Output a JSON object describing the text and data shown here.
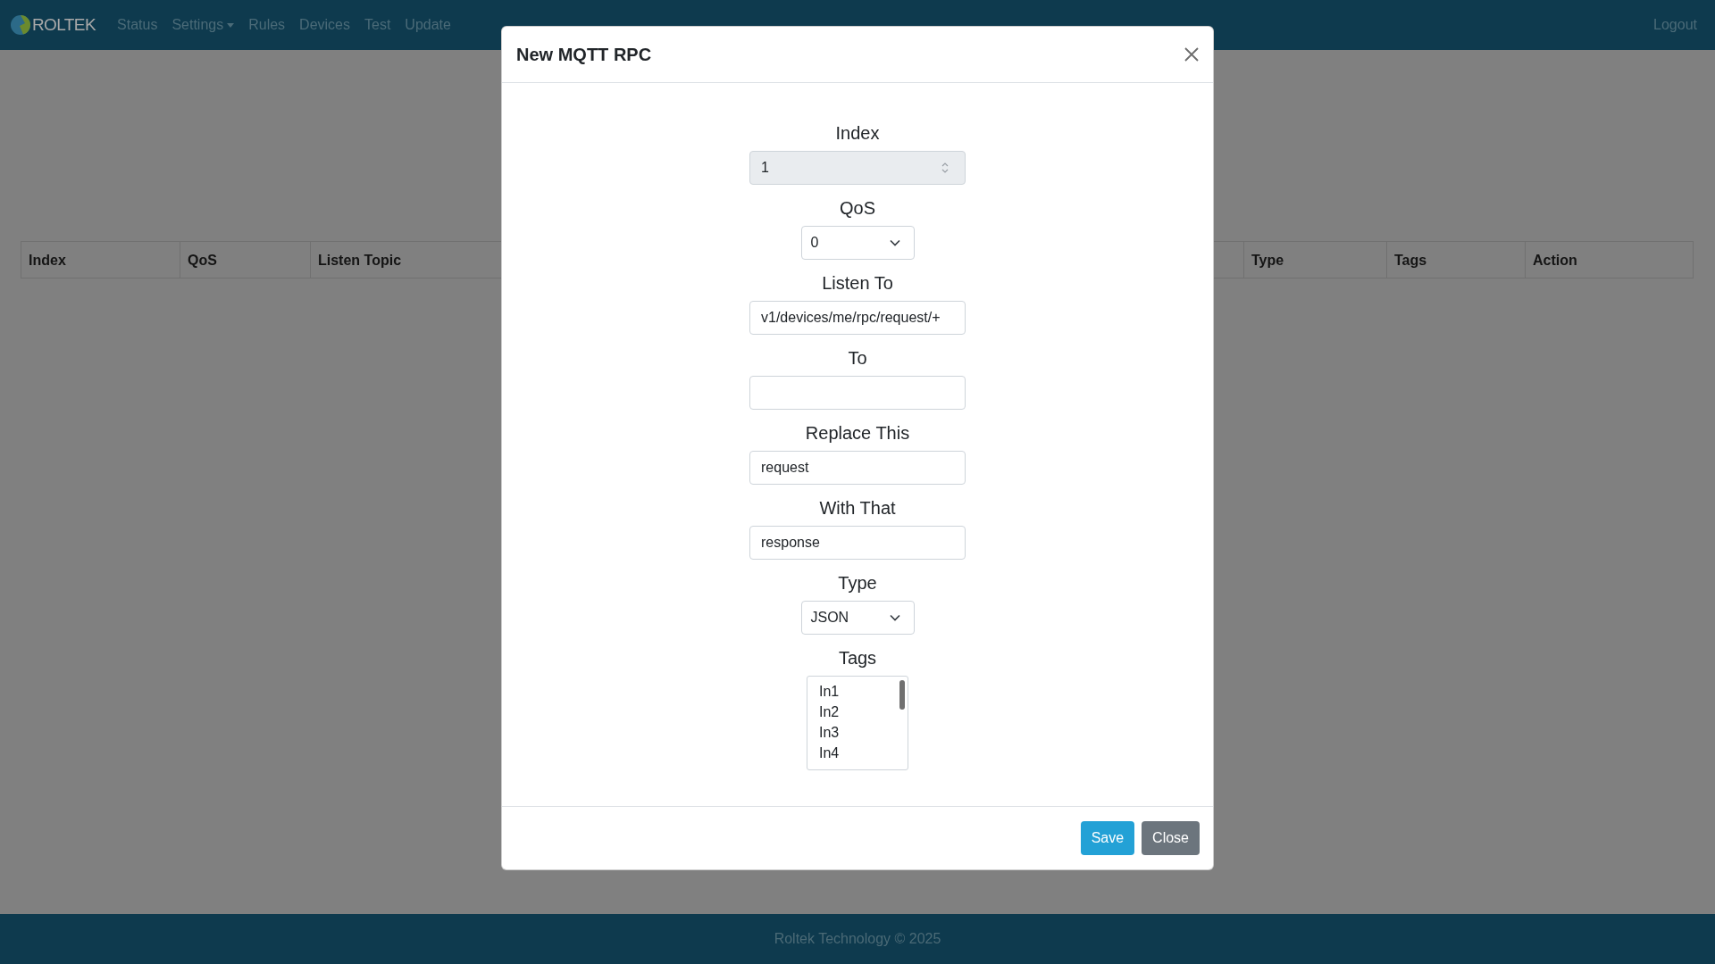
{
  "navbar": {
    "brand": "ROLTEK",
    "items": [
      {
        "label": "Status",
        "dropdown": false
      },
      {
        "label": "Settings",
        "dropdown": true
      },
      {
        "label": "Rules",
        "dropdown": false
      },
      {
        "label": "Devices",
        "dropdown": false
      },
      {
        "label": "Test",
        "dropdown": false
      },
      {
        "label": "Update",
        "dropdown": false
      }
    ],
    "logout": "Logout"
  },
  "table": {
    "columns": [
      "Index",
      "QoS",
      "Listen Topic",
      "Type",
      "Tags",
      "Action"
    ]
  },
  "modal": {
    "title": "New MQTT RPC",
    "fields": [
      {
        "label": "Index",
        "kind": "number",
        "value": "1",
        "disabled": true
      },
      {
        "label": "QoS",
        "kind": "select",
        "value": "0",
        "disabled": false
      },
      {
        "label": "Listen To",
        "kind": "text",
        "value": "v1/devices/me/rpc/request/+",
        "disabled": false
      },
      {
        "label": "To",
        "kind": "text",
        "disabled": false
      },
      {
        "label": "Replace This",
        "kind": "text",
        "value": "request",
        "disabled": false
      },
      {
        "label": "With That",
        "kind": "text",
        "value": "response",
        "disabled": false
      },
      {
        "label": "Type",
        "kind": "select",
        "value": "JSON",
        "disabled": false
      },
      {
        "label": "Tags",
        "kind": "listbox",
        "disabled": false,
        "options": [
          {
            "label": "In1",
            "selected": false
          },
          {
            "label": "In2",
            "selected": false
          },
          {
            "label": "In3",
            "selected": false
          },
          {
            "label": "In4",
            "selected": false
          }
        ]
      }
    ],
    "buttons": [
      {
        "label": "Save",
        "kind": "primary"
      },
      {
        "label": "Close",
        "kind": "secondary"
      }
    ]
  },
  "footer": {
    "text": "Roltek Technology © 2025"
  }
}
